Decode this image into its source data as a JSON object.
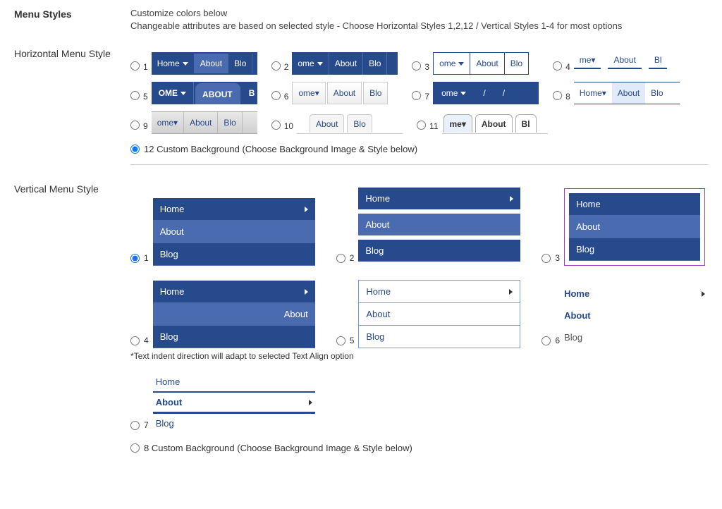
{
  "header": {
    "title": "Menu Styles",
    "desc1": "Customize colors below",
    "desc2": "Changeable attributes are based on selected style - Choose Horizontal Styles 1,2,12 / Vertical Styles 1-4 for most options"
  },
  "horizontal": {
    "label": "Horizontal Menu Style",
    "items": {
      "home": "Home",
      "about": "About",
      "blog": "Blog",
      "ome": "ome",
      "me": "me",
      "blo": "Blo",
      "bl": "Bl",
      "omeCaps": "OME",
      "aboutCaps": "ABOUT"
    },
    "nums": {
      "n1": "1",
      "n2": "2",
      "n3": "3",
      "n4": "4",
      "n5": "5",
      "n6": "6",
      "n7": "7",
      "n8": "8",
      "n9": "9",
      "n10": "10",
      "n11": "11"
    },
    "custom": "12 Custom Background (Choose Background Image & Style below)"
  },
  "vertical": {
    "label": "Vertical Menu Style",
    "items": {
      "home": "Home",
      "about": "About",
      "blog": "Blog"
    },
    "nums": {
      "n1": "1",
      "n2": "2",
      "n3": "3",
      "n4": "4",
      "n5": "5",
      "n6": "6",
      "n7": "7"
    },
    "footnote": "*Text indent direction will adapt to selected Text Align option",
    "custom": "8 Custom Background (Choose Background Image & Style below)"
  }
}
